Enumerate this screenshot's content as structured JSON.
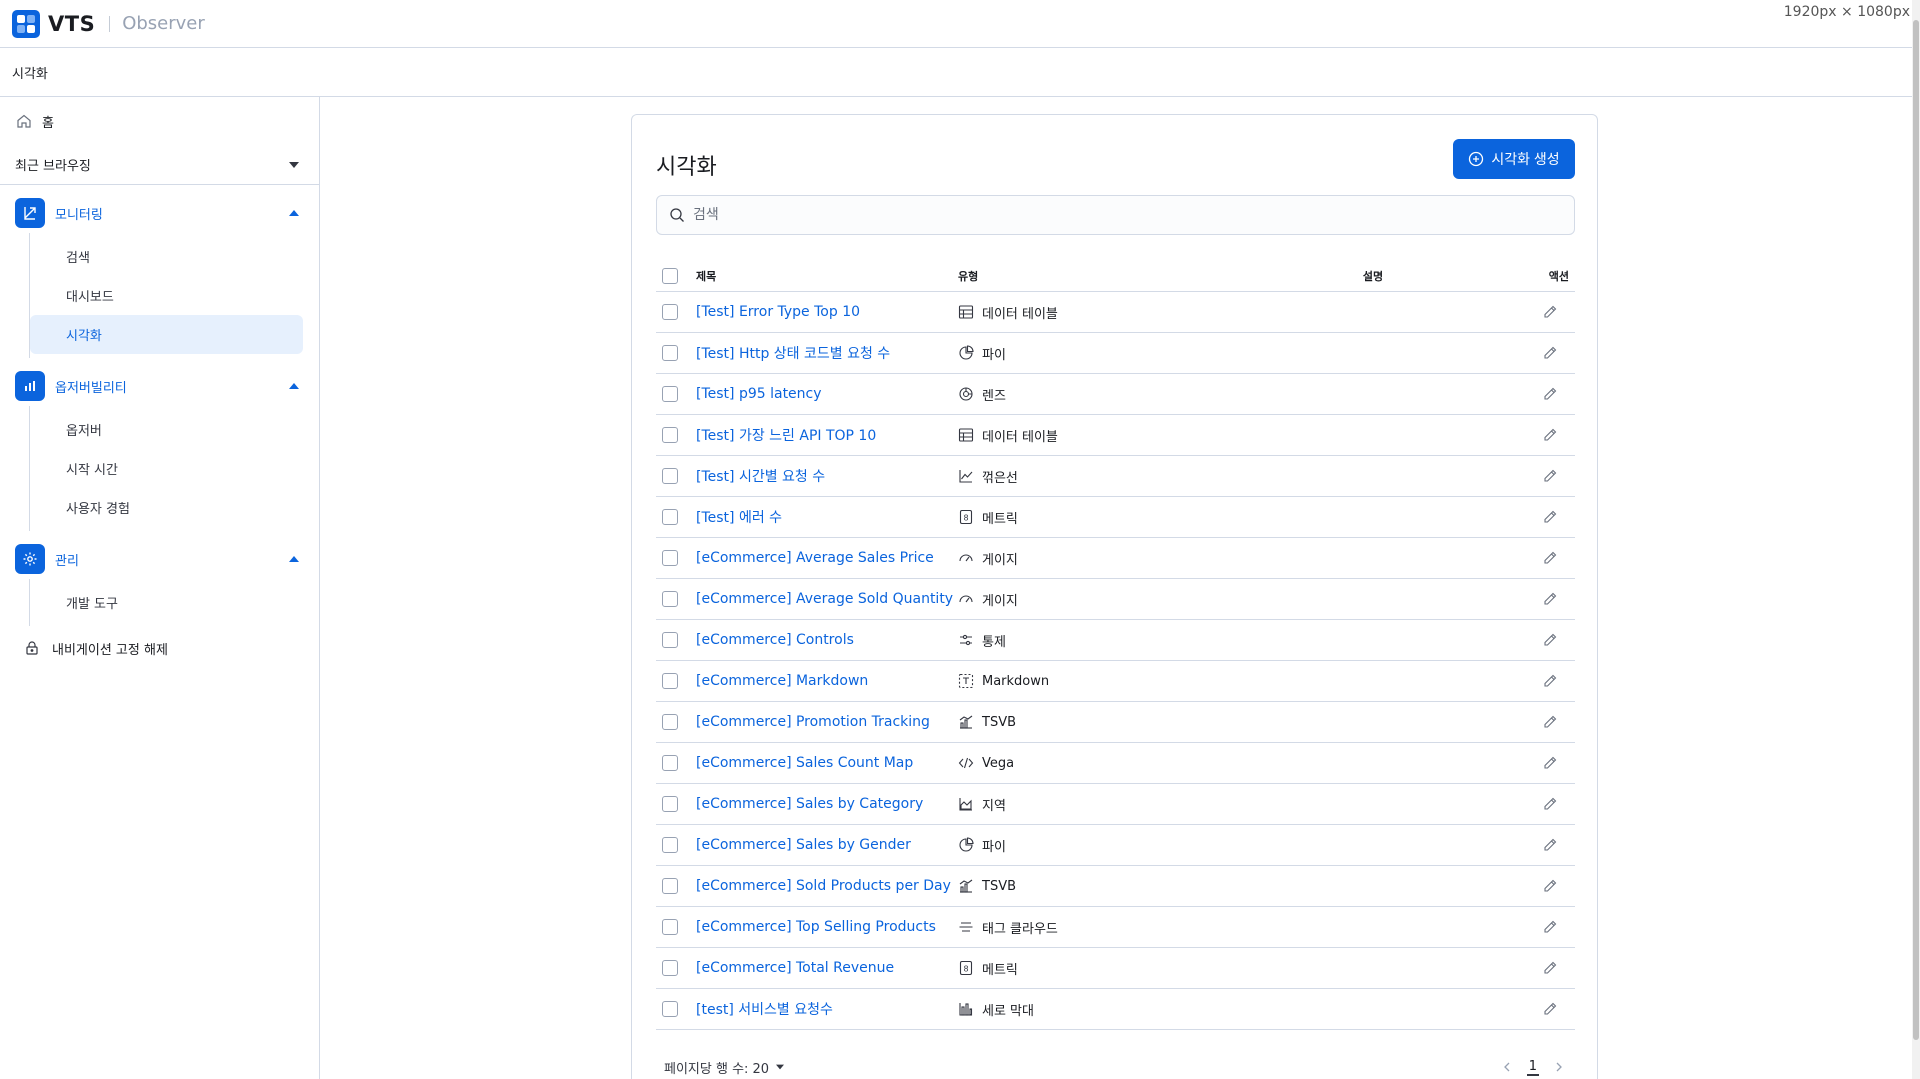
{
  "app": {
    "name": "VTS",
    "subtitle": "Observer",
    "viewport_label": "1920px × 1080px"
  },
  "breadcrumb": "시각화",
  "sidebar": {
    "home": "홈",
    "recent": "최근 브라우징",
    "sections": [
      {
        "label": "모니터링",
        "icon": "monitoring-icon",
        "items": [
          "검색",
          "대시보드",
          "시각화"
        ],
        "active": "시각화"
      },
      {
        "label": "옵저버빌리티",
        "icon": "observability-icon",
        "items": [
          "옵저버",
          "시작 시간",
          "사용자 경험"
        ]
      },
      {
        "label": "관리",
        "icon": "gear-icon",
        "items": [
          "개발 도구"
        ]
      }
    ],
    "unlock": "내비게이션 고정 해제"
  },
  "main": {
    "title": "시각화",
    "create_button": "시각화 생성",
    "search_placeholder": "검색",
    "columns": {
      "title": "제목",
      "type": "유형",
      "description": "설명",
      "actions": "액션"
    },
    "rows": [
      {
        "title": "[Test] Error Type Top 10",
        "type": "데이터 테이블",
        "icon": "table-icon"
      },
      {
        "title": "[Test] Http 상태 코드별 요청 수",
        "type": "파이",
        "icon": "pie-icon"
      },
      {
        "title": "[Test] p95 latency",
        "type": "렌즈",
        "icon": "lens-icon"
      },
      {
        "title": "[Test] 가장 느린 API TOP 10",
        "type": "데이터 테이블",
        "icon": "table-icon"
      },
      {
        "title": "[Test] 시간별 요청 수",
        "type": "꺾은선",
        "icon": "line-icon"
      },
      {
        "title": "[Test] 에러 수",
        "type": "메트릭",
        "icon": "metric-icon"
      },
      {
        "title": "[eCommerce] Average Sales Price",
        "type": "게이지",
        "icon": "gauge-icon"
      },
      {
        "title": "[eCommerce] Average Sold Quantity",
        "type": "게이지",
        "icon": "gauge-icon"
      },
      {
        "title": "[eCommerce] Controls",
        "type": "통제",
        "icon": "controls-icon"
      },
      {
        "title": "[eCommerce] Markdown",
        "type": "Markdown",
        "icon": "markdown-icon"
      },
      {
        "title": "[eCommerce] Promotion Tracking",
        "type": "TSVB",
        "icon": "tsvb-icon"
      },
      {
        "title": "[eCommerce] Sales Count Map",
        "type": "Vega",
        "icon": "code-icon"
      },
      {
        "title": "[eCommerce] Sales by Category",
        "type": "지역",
        "icon": "area-icon"
      },
      {
        "title": "[eCommerce] Sales by Gender",
        "type": "파이",
        "icon": "pie-icon"
      },
      {
        "title": "[eCommerce] Sold Products per Day",
        "type": "TSVB",
        "icon": "tsvb-icon"
      },
      {
        "title": "[eCommerce] Top Selling Products",
        "type": "태그 클라우드",
        "icon": "tagcloud-icon"
      },
      {
        "title": "[eCommerce] Total Revenue",
        "type": "메트릭",
        "icon": "metric-icon"
      },
      {
        "title": "[test] 서비스별 요청수",
        "type": "세로 막대",
        "icon": "bar-icon"
      }
    ],
    "rows_per_page": "페이지당 행 수: 20",
    "page": "1"
  },
  "colors": {
    "primary": "#0b64dd",
    "border": "#d3dae6"
  }
}
